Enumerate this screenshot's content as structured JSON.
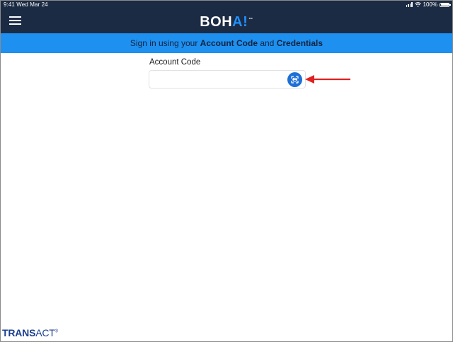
{
  "status_bar": {
    "time": "9:41  Wed Mar 24",
    "battery": "100%"
  },
  "header": {
    "logo_main": "BOH",
    "logo_accent": "A!",
    "logo_tm": "™"
  },
  "banner": {
    "prefix": "Sign in using your ",
    "account_code": "Account Code",
    "middle": " and ",
    "credentials": "Credentials"
  },
  "form": {
    "account_code_label": "Account Code",
    "account_code_value": "",
    "account_code_placeholder": ""
  },
  "footer": {
    "brand_bold": "TRANS",
    "brand_light": "ACT",
    "brand_reg": "®"
  },
  "colors": {
    "nav": "#1c2b44",
    "banner": "#1e90f0",
    "scan_button": "#1e6fd6",
    "annotation_arrow": "#e02020",
    "brand": "#1a3e8f"
  },
  "icons": {
    "menu": "hamburger-menu-icon",
    "scan": "qr-scan-icon",
    "arrow": "red-arrow-annotation"
  }
}
